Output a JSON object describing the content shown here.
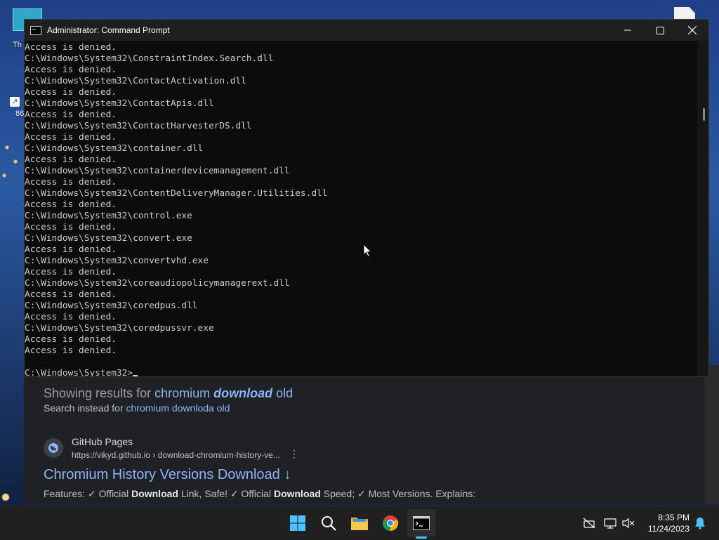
{
  "desktop": {
    "icon1_label": "Th",
    "icon2_label": "86",
    "shortcut_glyph": "↗"
  },
  "browser": {
    "showing_prefix": "Showing results for ",
    "showing_term1": "chromium ",
    "showing_term2": "download",
    "showing_term3": " old",
    "instead_prefix": "Search instead for ",
    "instead_link": "chromium downloda old",
    "result": {
      "site_name": "GitHub Pages",
      "url": "https://vikyd.github.io › download-chromium-history-ve...",
      "more": "⋮",
      "title": "Chromium History Versions Download ↓",
      "snippet_parts": [
        "Features: ✓ Official ",
        "Download",
        " Link, Safe! ✓ Official ",
        "Download",
        " Speed; ✓ Most Versions. Explains:"
      ]
    }
  },
  "cmd": {
    "title": "Administrator: Command Prompt",
    "minimize": "—",
    "close": "✕",
    "lines": [
      "Access is denied.",
      "C:\\Windows\\System32\\ConstraintIndex.Search.dll",
      "Access is denied.",
      "C:\\Windows\\System32\\ContactActivation.dll",
      "Access is denied.",
      "C:\\Windows\\System32\\ContactApis.dll",
      "Access is denied.",
      "C:\\Windows\\System32\\ContactHarvesterDS.dll",
      "Access is denied.",
      "C:\\Windows\\System32\\container.dll",
      "Access is denied.",
      "C:\\Windows\\System32\\containerdevicemanagement.dll",
      "Access is denied.",
      "C:\\Windows\\System32\\ContentDeliveryManager.Utilities.dll",
      "Access is denied.",
      "C:\\Windows\\System32\\control.exe",
      "Access is denied.",
      "C:\\Windows\\System32\\convert.exe",
      "Access is denied.",
      "C:\\Windows\\System32\\convertvhd.exe",
      "Access is denied.",
      "C:\\Windows\\System32\\coreaudiopolicymanagerext.dll",
      "Access is denied.",
      "C:\\Windows\\System32\\coredpus.dll",
      "Access is denied.",
      "C:\\Windows\\System32\\coredpussvr.exe",
      "Access is denied.",
      "Access is denied.",
      ""
    ],
    "prompt": "C:\\Windows\\System32>"
  },
  "taskbar": {
    "time": "8:35 PM",
    "date": "11/24/2023",
    "accent": "#4cc2ff"
  },
  "icons": [
    "windows-start-icon",
    "search-icon",
    "file-explorer-icon",
    "chrome-icon",
    "command-prompt-icon",
    "network-off-icon",
    "display-icon",
    "volume-muted-icon",
    "notification-bell-icon"
  ]
}
